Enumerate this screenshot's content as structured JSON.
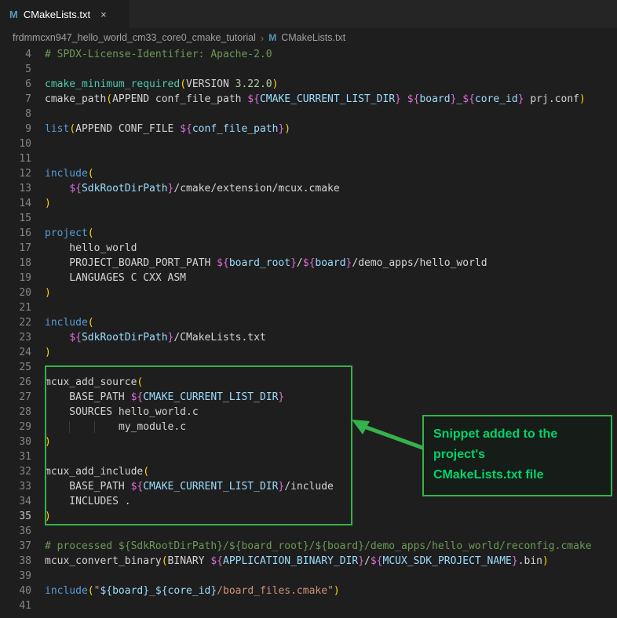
{
  "tab": {
    "icon": "M",
    "label": "CMakeLists.txt",
    "close": "×"
  },
  "breadcrumb": {
    "folder": "frdmmcxn947_hello_world_cm33_core0_cmake_tutorial",
    "separator": "›",
    "file_icon": "M",
    "file": "CMakeLists.txt"
  },
  "colors": {
    "comment": "#6A9955",
    "command": "#569CD6",
    "function": "#4EC9B0",
    "text": "#D4D4D4",
    "variable": "#9CDCFE",
    "number": "#B5CEA8",
    "string": "#CE9178",
    "bracket1": "#FFD700",
    "bracket2": "#DA70D6",
    "background": "#1E1E1E",
    "line_number": "#858585",
    "active_line_number": "#C6C6C6"
  },
  "annotation": {
    "lines": [
      "Snippet added to the",
      "project's",
      "CMakeLists.txt file"
    ],
    "border_color": "#35B24C",
    "text_color": "#00D36B",
    "highlighted_lines": "26-35"
  },
  "editor": {
    "lines": [
      {
        "n": 4,
        "tokens": [
          [
            "comment",
            "# SPDX-License-Identifier: Apache-2.0"
          ]
        ]
      },
      {
        "n": 5,
        "tokens": []
      },
      {
        "n": 6,
        "tokens": [
          [
            "fn",
            "cmake_minimum_required"
          ],
          [
            "b1",
            "("
          ],
          [
            "t",
            "VERSION "
          ],
          [
            "num",
            "3.22.0"
          ],
          [
            "b1",
            ")"
          ]
        ]
      },
      {
        "n": 7,
        "tokens": [
          [
            "t",
            "cmake_path"
          ],
          [
            "b1",
            "("
          ],
          [
            "t",
            "APPEND conf_file_path "
          ],
          [
            "b2",
            "${"
          ],
          [
            "var",
            "CMAKE_CURRENT_LIST_DIR"
          ],
          [
            "b2",
            "}"
          ],
          [
            "t",
            " "
          ],
          [
            "b2",
            "${"
          ],
          [
            "var",
            "board"
          ],
          [
            "b2",
            "}"
          ],
          [
            "t",
            "_"
          ],
          [
            "b2",
            "${"
          ],
          [
            "var",
            "core_id"
          ],
          [
            "b2",
            "}"
          ],
          [
            "t",
            " prj.conf"
          ],
          [
            "b1",
            ")"
          ]
        ]
      },
      {
        "n": 8,
        "tokens": []
      },
      {
        "n": 9,
        "tokens": [
          [
            "cmd",
            "list"
          ],
          [
            "b1",
            "("
          ],
          [
            "t",
            "APPEND CONF_FILE "
          ],
          [
            "b2",
            "${"
          ],
          [
            "var",
            "conf_file_path"
          ],
          [
            "b2",
            "}"
          ],
          [
            "b1",
            ")"
          ]
        ]
      },
      {
        "n": 10,
        "tokens": []
      },
      {
        "n": 11,
        "tokens": []
      },
      {
        "n": 12,
        "tokens": [
          [
            "cmd",
            "include"
          ],
          [
            "b1",
            "("
          ]
        ]
      },
      {
        "n": 13,
        "tokens": [
          [
            "t",
            "    "
          ],
          [
            "b2",
            "${"
          ],
          [
            "var",
            "SdkRootDirPath"
          ],
          [
            "b2",
            "}"
          ],
          [
            "t",
            "/cmake/extension/mcux.cmake"
          ]
        ]
      },
      {
        "n": 14,
        "tokens": [
          [
            "b1",
            ")"
          ]
        ]
      },
      {
        "n": 15,
        "tokens": []
      },
      {
        "n": 16,
        "tokens": [
          [
            "cmd",
            "project"
          ],
          [
            "b1",
            "("
          ]
        ]
      },
      {
        "n": 17,
        "tokens": [
          [
            "t",
            "    hello_world"
          ]
        ]
      },
      {
        "n": 18,
        "tokens": [
          [
            "t",
            "    PROJECT_BOARD_PORT_PATH "
          ],
          [
            "b2",
            "${"
          ],
          [
            "var",
            "board_root"
          ],
          [
            "b2",
            "}"
          ],
          [
            "t",
            "/"
          ],
          [
            "b2",
            "${"
          ],
          [
            "var",
            "board"
          ],
          [
            "b2",
            "}"
          ],
          [
            "t",
            "/demo_apps/hello_world"
          ]
        ]
      },
      {
        "n": 19,
        "tokens": [
          [
            "t",
            "    LANGUAGES C CXX ASM"
          ]
        ]
      },
      {
        "n": 20,
        "tokens": [
          [
            "b1",
            ")"
          ]
        ]
      },
      {
        "n": 21,
        "tokens": []
      },
      {
        "n": 22,
        "tokens": [
          [
            "cmd",
            "include"
          ],
          [
            "b1",
            "("
          ]
        ]
      },
      {
        "n": 23,
        "tokens": [
          [
            "t",
            "    "
          ],
          [
            "b2",
            "${"
          ],
          [
            "var",
            "SdkRootDirPath"
          ],
          [
            "b2",
            "}"
          ],
          [
            "t",
            "/CMakeLists.txt"
          ]
        ]
      },
      {
        "n": 24,
        "tokens": [
          [
            "b1",
            ")"
          ]
        ]
      },
      {
        "n": 25,
        "tokens": []
      },
      {
        "n": 26,
        "tokens": [
          [
            "t",
            "mcux_add_source"
          ],
          [
            "b1",
            "("
          ]
        ]
      },
      {
        "n": 27,
        "tokens": [
          [
            "t",
            "    BASE_PATH "
          ],
          [
            "b2",
            "${"
          ],
          [
            "var",
            "CMAKE_CURRENT_LIST_DIR"
          ],
          [
            "b2",
            "}"
          ]
        ]
      },
      {
        "n": 28,
        "tokens": [
          [
            "t",
            "    SOURCES hello_world.c"
          ]
        ]
      },
      {
        "n": 29,
        "tokens": [
          [
            "t",
            "    "
          ],
          [
            "guide",
            "    "
          ],
          [
            "guide",
            "    "
          ],
          [
            "t",
            "my_module.c"
          ]
        ]
      },
      {
        "n": 30,
        "tokens": [
          [
            "b1",
            ")"
          ]
        ]
      },
      {
        "n": 31,
        "tokens": []
      },
      {
        "n": 32,
        "tokens": [
          [
            "t",
            "mcux_add_include"
          ],
          [
            "b1",
            "("
          ]
        ]
      },
      {
        "n": 33,
        "tokens": [
          [
            "t",
            "    BASE_PATH "
          ],
          [
            "b2",
            "${"
          ],
          [
            "var",
            "CMAKE_CURRENT_LIST_DIR"
          ],
          [
            "b2",
            "}"
          ],
          [
            "t",
            "/include"
          ]
        ]
      },
      {
        "n": 34,
        "tokens": [
          [
            "t",
            "    INCLUDES ."
          ]
        ]
      },
      {
        "n": 35,
        "active": true,
        "tokens": [
          [
            "b1",
            ")"
          ]
        ]
      },
      {
        "n": 36,
        "tokens": []
      },
      {
        "n": 37,
        "tokens": [
          [
            "comment",
            "# processed ${SdkRootDirPath}/${board_root}/${board}/demo_apps/hello_world/reconfig.cmake"
          ]
        ]
      },
      {
        "n": 38,
        "tokens": [
          [
            "t",
            "mcux_convert_binary"
          ],
          [
            "b1",
            "("
          ],
          [
            "t",
            "BINARY "
          ],
          [
            "b2",
            "${"
          ],
          [
            "var",
            "APPLICATION_BINARY_DIR"
          ],
          [
            "b2",
            "}"
          ],
          [
            "t",
            "/"
          ],
          [
            "b2",
            "${"
          ],
          [
            "var",
            "MCUX_SDK_PROJECT_NAME"
          ],
          [
            "b2",
            "}"
          ],
          [
            "t",
            ".bin"
          ],
          [
            "b1",
            ")"
          ]
        ]
      },
      {
        "n": 39,
        "tokens": []
      },
      {
        "n": 40,
        "tokens": [
          [
            "cmd",
            "include"
          ],
          [
            "b1",
            "("
          ],
          [
            "str",
            "\""
          ],
          [
            "var",
            "${board}"
          ],
          [
            "str",
            "_"
          ],
          [
            "var",
            "${core_id}"
          ],
          [
            "str",
            "/board_files.cmake\""
          ],
          [
            "b1",
            ")"
          ]
        ]
      },
      {
        "n": 41,
        "tokens": []
      }
    ]
  }
}
